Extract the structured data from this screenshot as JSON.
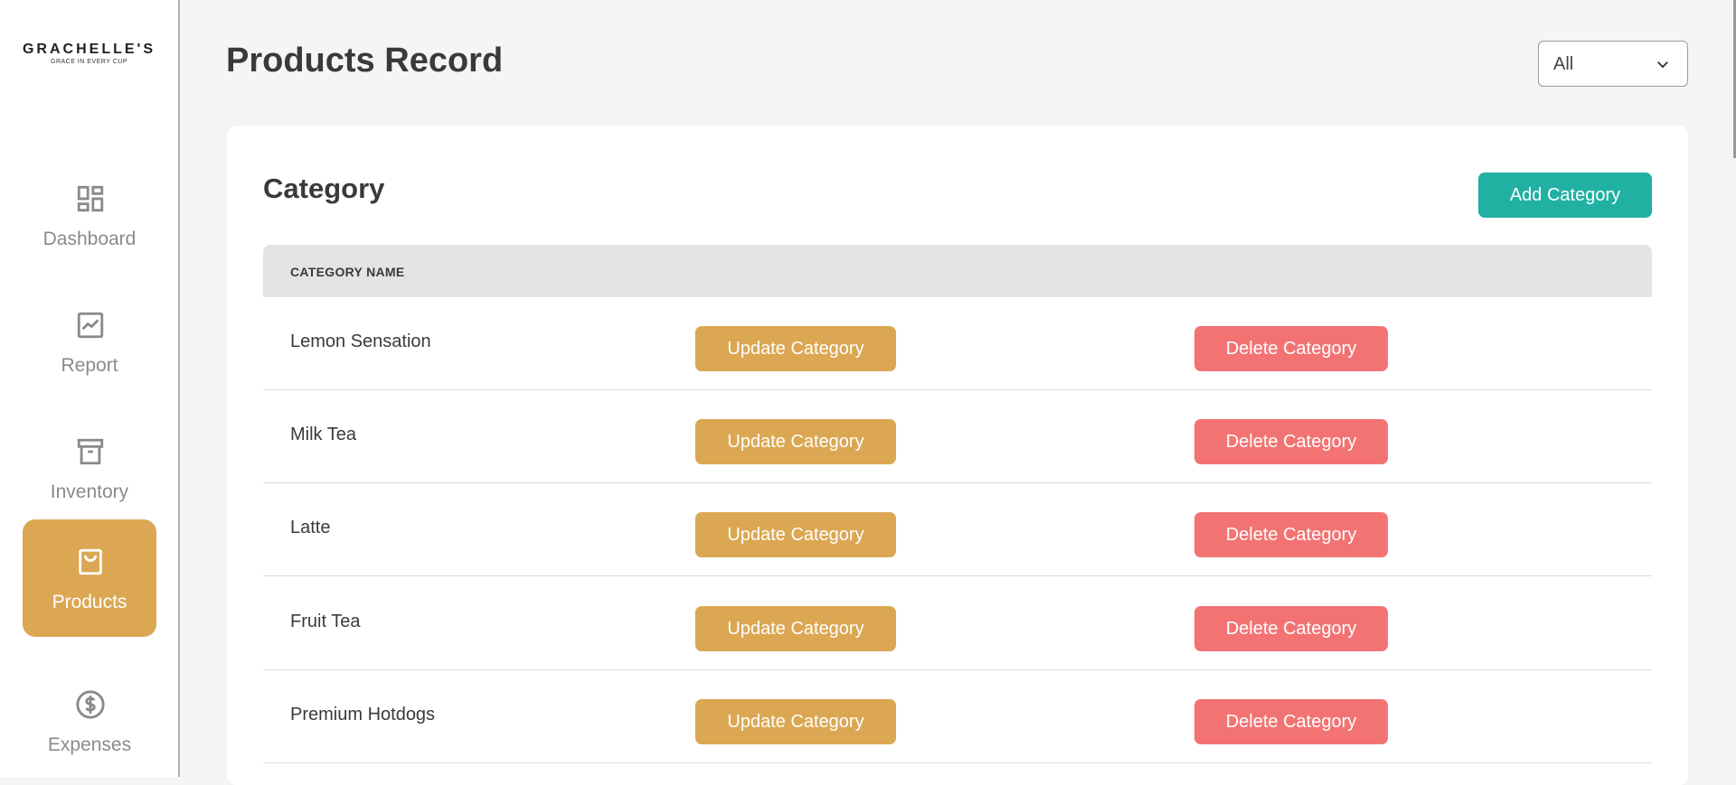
{
  "brand": {
    "name": "GRACHELLE'S",
    "tagline": "GRACE IN EVERY CUP"
  },
  "sidebar": {
    "items": [
      {
        "label": "Dashboard",
        "icon": "dashboard-icon",
        "active": false
      },
      {
        "label": "Report",
        "icon": "chart-icon",
        "active": false
      },
      {
        "label": "Inventory",
        "icon": "archive-box-icon",
        "active": false
      },
      {
        "label": "Products",
        "icon": "shopping-bag-icon",
        "active": true
      },
      {
        "label": "Expenses",
        "icon": "dollar-circle-icon",
        "active": false
      }
    ]
  },
  "header": {
    "title": "Products Record",
    "filter": {
      "selected": "All"
    }
  },
  "card": {
    "title": "Category",
    "add_label": "Add Category",
    "column_header": "CATEGORY NAME",
    "update_label": "Update Category",
    "delete_label": "Delete Category",
    "rows": [
      {
        "name": "Lemon Sensation"
      },
      {
        "name": "Milk Tea"
      },
      {
        "name": "Latte"
      },
      {
        "name": "Fruit Tea"
      },
      {
        "name": "Premium Hotdogs"
      }
    ]
  },
  "colors": {
    "accent": "#dba752",
    "add_button": "#20b1a2",
    "delete_button": "#f37373"
  }
}
